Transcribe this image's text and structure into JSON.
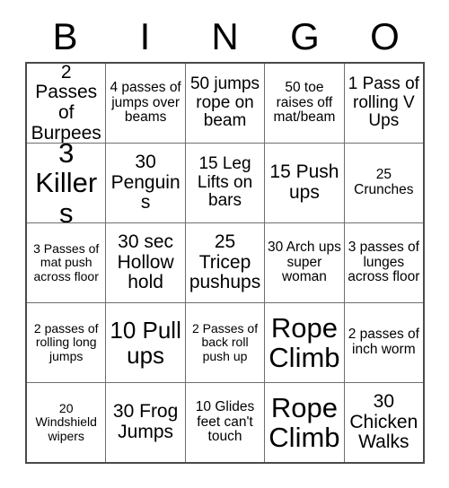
{
  "card": {
    "title_letters": [
      "B",
      "I",
      "N",
      "G",
      "O"
    ],
    "colors": {
      "background": "#ffffff",
      "text": "#000000",
      "grid_outer_border": "#4a4a4a",
      "grid_inner_border": "#6e6e6e"
    },
    "rows": [
      [
        {
          "text": "2 Passes of Burpees",
          "size": "md"
        },
        {
          "text": "4 passes of jumps over beams",
          "size": "xs"
        },
        {
          "text": "50 jumps rope on beam",
          "size": "sm"
        },
        {
          "text": "50 toe raises off mat/beam",
          "size": "xs"
        },
        {
          "text": "1 Pass of rolling V Ups",
          "size": "sm"
        }
      ],
      [
        {
          "text": "3 Killers",
          "size": "xl"
        },
        {
          "text": "30 Penguins",
          "size": "md"
        },
        {
          "text": "15 Leg Lifts on bars",
          "size": "sm"
        },
        {
          "text": "15 Push ups",
          "size": "md"
        },
        {
          "text": "25 Crunches",
          "size": "xs"
        }
      ],
      [
        {
          "text": "3 Passes of mat push across floor",
          "size": "xxs"
        },
        {
          "text": "30 sec Hollow hold",
          "size": "md"
        },
        {
          "text": "25 Tricep pushups",
          "size": "md"
        },
        {
          "text": "30 Arch ups super woman",
          "size": "xs"
        },
        {
          "text": "3 passes of lunges across floor",
          "size": "xs"
        }
      ],
      [
        {
          "text": "2 passes of rolling long jumps",
          "size": "xxs"
        },
        {
          "text": "10 Pull ups",
          "size": "lg"
        },
        {
          "text": "2 Passes of back roll push up",
          "size": "xxs"
        },
        {
          "text": "Rope Climb",
          "size": "xl"
        },
        {
          "text": "2 passes of inch worm",
          "size": "xs"
        }
      ],
      [
        {
          "text": "20 Windshield wipers",
          "size": "xxs"
        },
        {
          "text": "30 Frog Jumps",
          "size": "md"
        },
        {
          "text": "10 Glides feet can't touch",
          "size": "xs"
        },
        {
          "text": "Rope Climb",
          "size": "xl"
        },
        {
          "text": "30 Chicken Walks",
          "size": "md"
        }
      ]
    ]
  }
}
